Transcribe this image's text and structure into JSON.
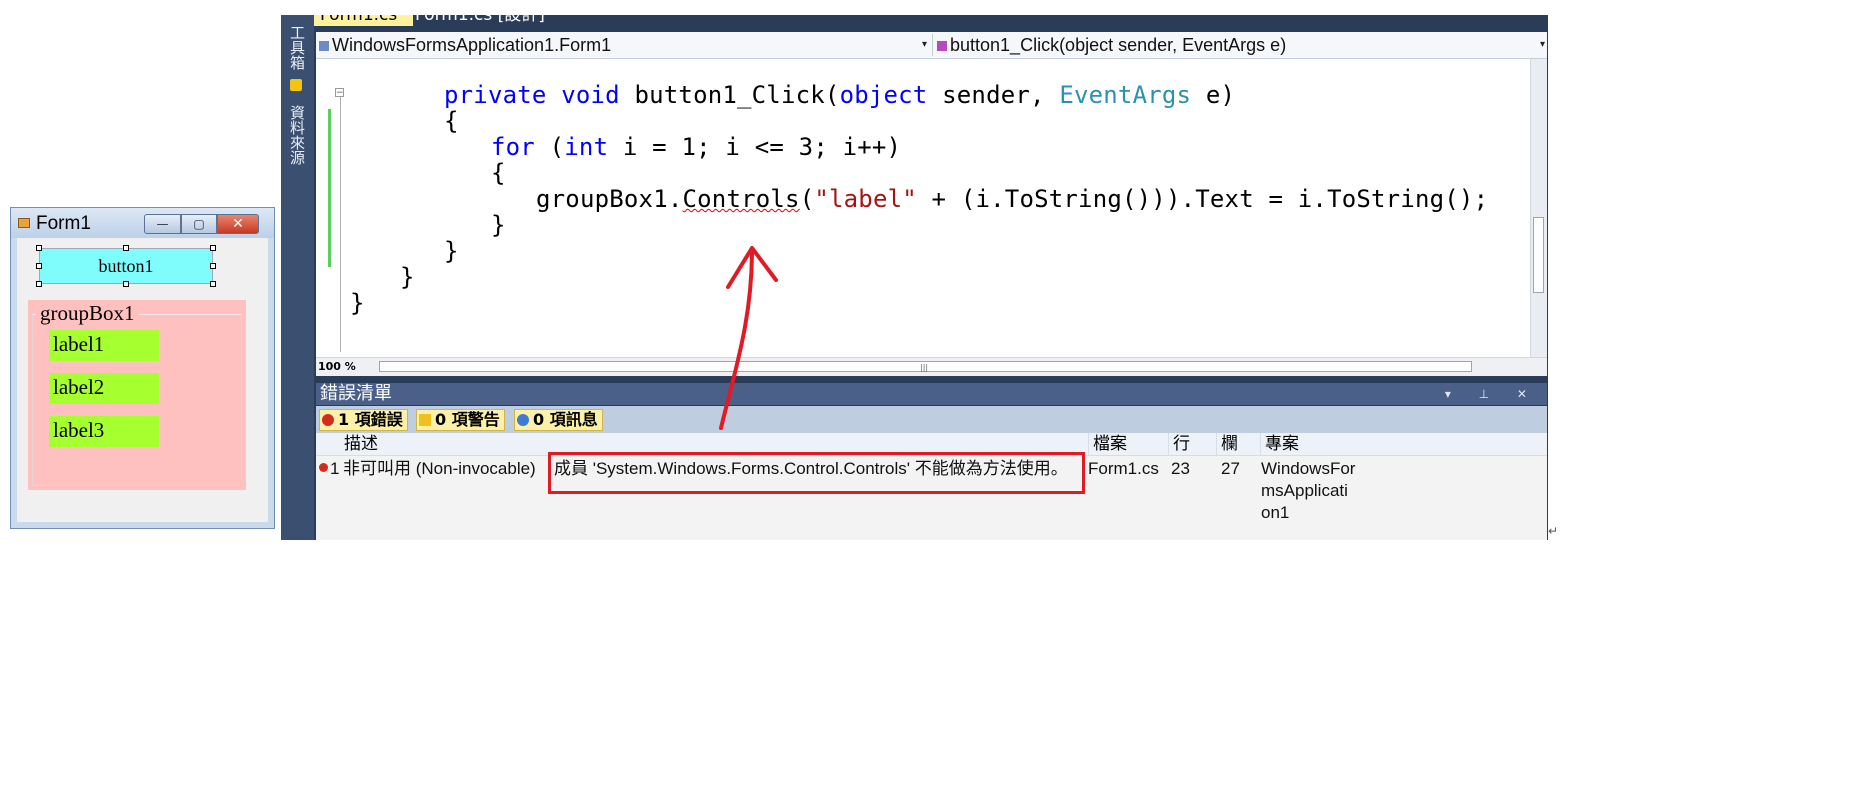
{
  "form_window": {
    "title": "Form1",
    "buttons": {
      "minimize": "—",
      "maximize": "▢",
      "close": "✕"
    },
    "button1_text": "button1",
    "groupbox_caption": "groupBox1",
    "labels": [
      "label1",
      "label2",
      "label3"
    ]
  },
  "ide": {
    "toolbox_tabs": [
      "工具箱",
      "資料來源"
    ],
    "doc_tabs": {
      "active": "Form1.cs",
      "inactive": "Form1.cs [設計]"
    },
    "nav": {
      "class_combo": "WindowsFormsApplication1.Form1",
      "member_combo": "button1_Click(object sender, EventArgs e)"
    },
    "code": {
      "line1": {
        "kw1": "private",
        "kw2": "void",
        "name": "button1_Click(",
        "kw3": "object",
        "mid": "sender, ",
        "type": "EventArgs",
        "end": "e)"
      },
      "line2": "{",
      "line3": {
        "kw": "for",
        "open": "(",
        "kw2": "int",
        "rest": "i = 1; i <= 3; i++)"
      },
      "line4": "{",
      "line5": {
        "pre": "groupBox1.",
        "squiggle": "Controls",
        "open": "(",
        "str": "\"label\"",
        "rest": " + (i.ToString())).Text = i.ToString();"
      },
      "line6": "}",
      "line7": "}",
      "line8": "}",
      "line9": "}"
    },
    "zoom": "100 %",
    "error_list": {
      "title": "錯誤清單",
      "filters": {
        "errors": "1 項錯誤",
        "warnings": "0 項警告",
        "messages": "0 項訊息"
      },
      "columns": {
        "description": "描述",
        "file": "檔案",
        "line": "行",
        "column": "欄",
        "project": "專案"
      },
      "rows": [
        {
          "index": "1",
          "description_prefix": "非可叫用 (Non-invocable)",
          "description": "成員 'System.Windows.Forms.Control.Controls' 不能做為方法使用。",
          "file": "Form1.cs",
          "line": "23",
          "column": "27",
          "project": "WindowsFormsApplication1"
        }
      ]
    }
  },
  "colors": {
    "button1_bg": "#7ffdfd",
    "groupbox_bg": "#ffc0c0",
    "label_bg": "#a6ff2e",
    "annotation_red": "#e01b24",
    "keyword": "#0000ff",
    "type": "#2b91af",
    "string": "#a31515"
  }
}
